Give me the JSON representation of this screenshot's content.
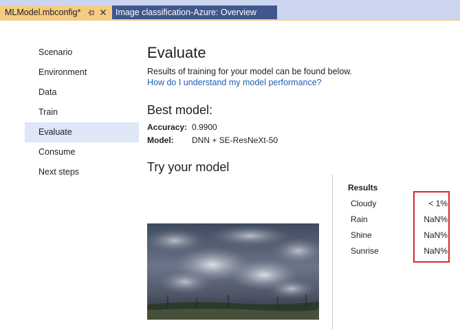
{
  "tabs": {
    "active": {
      "label": "MLModel.mbconfig*"
    },
    "inactive": {
      "label": "Image classification-Azure: Overview"
    }
  },
  "icons": {
    "pin": "pin-icon",
    "close": "close-icon"
  },
  "nav": {
    "items": [
      {
        "label": "Scenario",
        "selected": false
      },
      {
        "label": "Environment",
        "selected": false
      },
      {
        "label": "Data",
        "selected": false
      },
      {
        "label": "Train",
        "selected": false
      },
      {
        "label": "Evaluate",
        "selected": true
      },
      {
        "label": "Consume",
        "selected": false
      },
      {
        "label": "Next steps",
        "selected": false
      }
    ]
  },
  "main": {
    "title": "Evaluate",
    "subtitle": "Results of training for your model can be found below.",
    "help_link": "How do I understand my model performance?",
    "best_model": {
      "heading": "Best model:",
      "accuracy_label": "Accuracy:",
      "accuracy_value": "0.9900",
      "model_label": "Model:",
      "model_value": "DNN + SE-ResNeXt-50"
    },
    "try_heading": "Try your model"
  },
  "results": {
    "header": "Results",
    "rows": [
      {
        "label": "Cloudy",
        "value": "< 1%"
      },
      {
        "label": "Rain",
        "value": "NaN%"
      },
      {
        "label": "Shine",
        "value": "NaN%"
      },
      {
        "label": "Sunrise",
        "value": "NaN%"
      }
    ]
  },
  "colors": {
    "tabstrip": "#cbd5ef",
    "active_tab": "#f5cc84",
    "inactive_tab": "#40568d",
    "nav_selected": "#dfe6f7",
    "link": "#1a5fb4",
    "highlight": "#d6262b"
  }
}
